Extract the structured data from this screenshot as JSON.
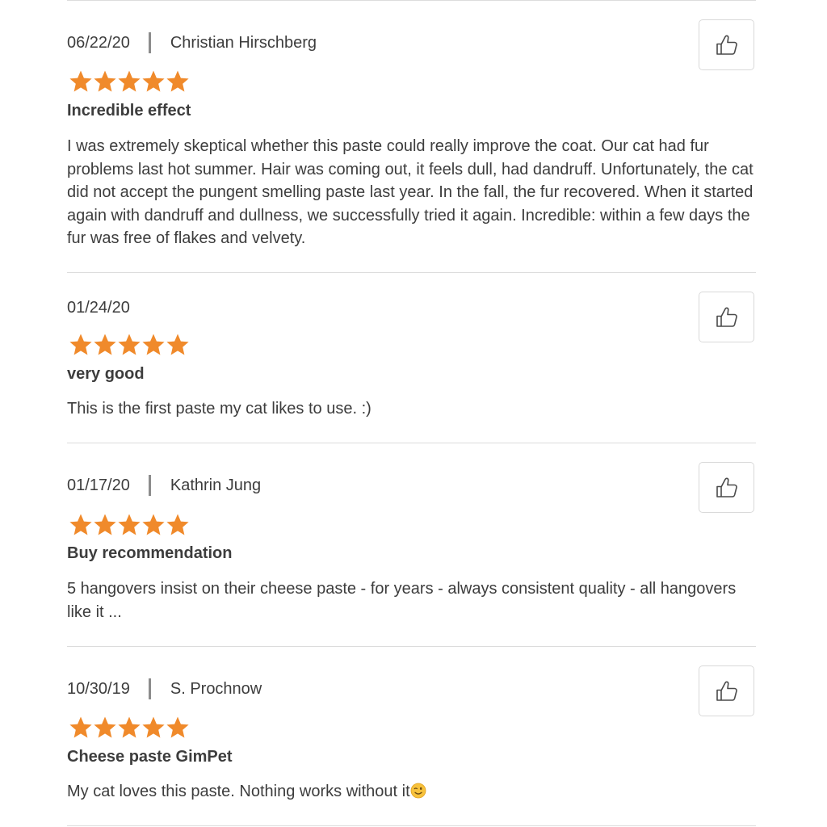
{
  "colors": {
    "star": "#f08a2b",
    "text": "#3d3d3d",
    "divider": "#dcdcdc",
    "button_border": "#d9d9d9"
  },
  "icons": {
    "rating": "star-icon",
    "like": "thumbs-up-icon",
    "emoji": "winking-face-emoji"
  },
  "reviews": [
    {
      "date": "06/22/20",
      "author": "Christian Hirschberg",
      "rating": 5,
      "title": "Incredible effect",
      "lines": [
        "I was extremely skeptical whether this paste could really improve the coat. Our cat had fur",
        "problems last hot summer. Hair was coming out, it feels dull, had dandruff. Unfortunately, the cat",
        "did not accept the pungent smelling paste last year. In the fall, the fur recovered. When it started",
        "again with dandruff and dullness, we successfully tried it again. Incredible: within a few days the",
        "fur was free of flakes and velvety."
      ]
    },
    {
      "date": "01/24/20",
      "author": "",
      "rating": 5,
      "title": "very good",
      "lines": [
        "This is the first paste my cat likes to use. :)"
      ]
    },
    {
      "date": "01/17/20",
      "author": "Kathrin Jung",
      "rating": 5,
      "title": "Buy recommendation",
      "lines": [
        "5 hangovers insist on their cheese paste - for years - always consistent quality - all hangovers",
        "like it ..."
      ]
    },
    {
      "date": "10/30/19",
      "author": "S. Prochnow",
      "rating": 5,
      "title": "Cheese paste GimPet",
      "lines": [
        "My cat loves this paste. Nothing works without it"
      ]
    }
  ]
}
